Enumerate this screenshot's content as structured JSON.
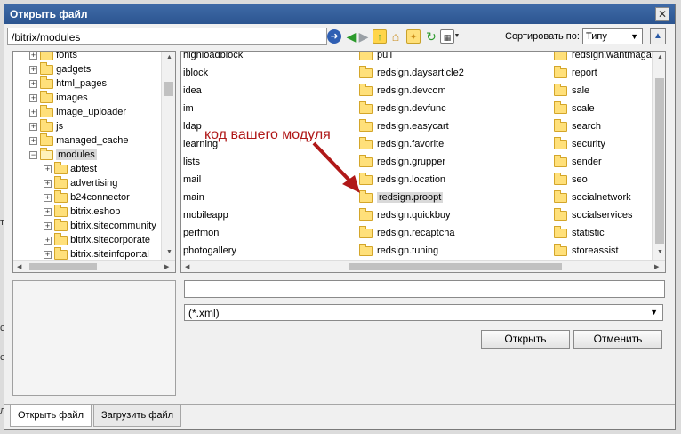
{
  "dialog": {
    "title": "Открыть файл",
    "close_symbol": "✕"
  },
  "toolbar": {
    "path": "/bitrix/modules",
    "sort_label": "Сортировать по:",
    "sort_value": "Типу",
    "icons": [
      "go-icon",
      "back-icon",
      "forward-icon",
      "folder-up-icon",
      "home-icon",
      "new-folder-icon",
      "refresh-icon",
      "view-mode-icon"
    ]
  },
  "tree": {
    "items": [
      {
        "label": "fonts",
        "expander": "+",
        "indent": 0
      },
      {
        "label": "gadgets",
        "expander": "+",
        "indent": 0
      },
      {
        "label": "html_pages",
        "expander": "+",
        "indent": 0
      },
      {
        "label": "images",
        "expander": "+",
        "indent": 0
      },
      {
        "label": "image_uploader",
        "expander": "+",
        "indent": 0
      },
      {
        "label": "js",
        "expander": "+",
        "indent": 0
      },
      {
        "label": "managed_cache",
        "expander": "+",
        "indent": 0
      },
      {
        "label": "modules",
        "expander": "−",
        "indent": 0,
        "selected": true
      },
      {
        "label": "abtest",
        "expander": "+",
        "indent": 1
      },
      {
        "label": "advertising",
        "expander": "+",
        "indent": 1
      },
      {
        "label": "b24connector",
        "expander": "+",
        "indent": 1
      },
      {
        "label": "bitrix.eshop",
        "expander": "+",
        "indent": 1
      },
      {
        "label": "bitrix.sitecommunity",
        "expander": "+",
        "indent": 1
      },
      {
        "label": "bitrix.sitecorporate",
        "expander": "+",
        "indent": 1
      },
      {
        "label": "bitrix.siteinfoportal",
        "expander": "+",
        "indent": 1
      }
    ]
  },
  "files": {
    "col1": [
      "highloadblock",
      "iblock",
      "idea",
      "im",
      "ldap",
      "learning",
      "lists",
      "mail",
      "main",
      "mobileapp",
      "perfmon",
      "photogallery"
    ],
    "col2": [
      "pull",
      "redsign.daysarticle2",
      "redsign.devcom",
      "redsign.devfunc",
      "redsign.easycart",
      "redsign.favorite",
      "redsign.grupper",
      "redsign.location",
      "redsign.proopt",
      "redsign.quickbuy",
      "redsign.recaptcha",
      "redsign.tuning"
    ],
    "col3": [
      "redsign.wantmaga",
      "report",
      "sale",
      "scale",
      "search",
      "security",
      "sender",
      "seo",
      "socialnetwork",
      "socialservices",
      "statistic",
      "storeassist"
    ],
    "selected": "redsign.proopt"
  },
  "annotation": "код вашего модуля",
  "filename": {
    "value": ""
  },
  "filetype": {
    "value": "(*.xml)"
  },
  "buttons": {
    "open": "Открыть",
    "cancel": "Отменить"
  },
  "tabs": [
    {
      "label": "Открыть файл",
      "active": true
    },
    {
      "label": "Загрузить файл",
      "active": false
    }
  ],
  "background": {
    "chars": [
      "т",
      "с",
      "с",
      "л"
    ]
  },
  "colors": {
    "title_bar": "#2c5590",
    "annotation": "#b01818",
    "folder": "#ffe07a"
  }
}
